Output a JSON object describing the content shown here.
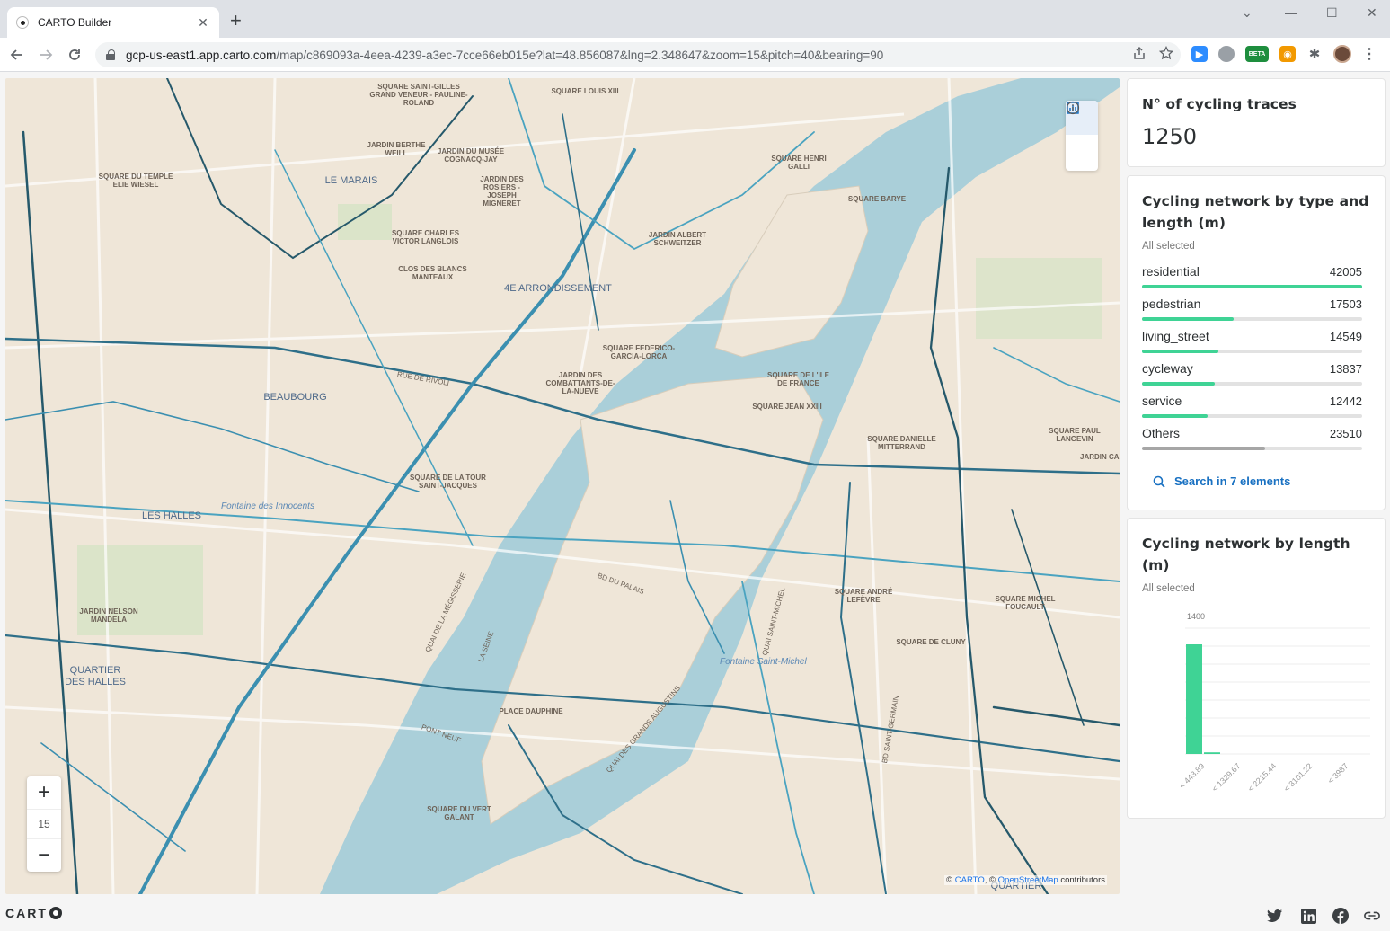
{
  "browser": {
    "tab_title": "CARTO Builder",
    "url_host": "gcp-us-east1.app.carto.com",
    "url_path": "/map/c869093a-4eea-4239-a3ec-7cce66eb015e?lat=48.856087&lng=2.348647&zoom=15&pitch=40&bearing=90",
    "ext_beta_label": "BETA"
  },
  "map": {
    "zoom_level": "15",
    "attribution_prefix": "© ",
    "attribution_carto": "CARTO",
    "attribution_sep": ", © ",
    "attribution_osm": "OpenStreetMap",
    "attribution_suffix": " contributors",
    "labels": [
      "SQUARE SAINT-GILLES GRAND VENEUR - PAULINE-ROLAND",
      "SQUARE LOUIS XIII",
      "JARDIN BERTHE WEILL",
      "JARDIN DU MUSÉE COGNACQ-JAY",
      "SQUARE DU TEMPLE ELIE WIESEL",
      "JARDIN DES ROSIERS - JOSEPH MIGNERET",
      "SQUARE HENRI GALLI",
      "SQUARE BARYE",
      "SQUARE CHARLES VICTOR LANGLOIS",
      "JARDIN ALBERT SCHWEITZER",
      "CLOS DES BLANCS MANTEAUX",
      "SQUARE FEDERICO-GARCIA-LORCA",
      "JARDIN DES COMBATTANTS-DE-LA-NUEVE",
      "SQUARE DE L'ILE DE FRANCE",
      "SQUARE JEAN XXIII",
      "SQUARE DANIELLE MITTERRAND",
      "SQUARE PAUL LANGEVIN",
      "SQUARE DE LA TOUR SAINT-JACQUES",
      "JARDIN NELSON MANDELA",
      "SQUARE ANDRÉ LEFÈVRE",
      "SQUARE MICHEL FOUCAULT",
      "SQUARE DE CLUNY",
      "PLACE DAUPHINE",
      "SQUARE DU VERT GALANT"
    ],
    "districts": [
      "LE MARAIS",
      "4E ARRONDISSEMENT",
      "BEAUBOURG",
      "LES HALLES",
      "QUARTIER DES HALLES",
      "QUARTIER",
      "JARDIN CA"
    ],
    "water_labels": [
      "Fontaine des Innocents",
      "Fontaine Saint-Michel"
    ],
    "street_labels": [
      "La Seine",
      "Quai Saint-Michel",
      "Bd Saint-Germain",
      "Quai des Grands Augustins",
      "Pont Neuf",
      "Rue de Rivoli",
      "Quai de la Mégisserie",
      "Bd du Palais"
    ]
  },
  "widgets": {
    "traces": {
      "title": "N° of cycling traces",
      "value": "1250"
    },
    "by_type": {
      "title": "Cycling network by type and length (m)",
      "subtitle": "All selected",
      "max_value": 42005,
      "categories": [
        {
          "name": "residential",
          "value": 42005,
          "value_label": "42005",
          "color": "#3fd395"
        },
        {
          "name": "pedestrian",
          "value": 17503,
          "value_label": "17503",
          "color": "#3fd395"
        },
        {
          "name": "living_street",
          "value": 14549,
          "value_label": "14549",
          "color": "#3fd395"
        },
        {
          "name": "cycleway",
          "value": 13837,
          "value_label": "13837",
          "color": "#3fd395"
        },
        {
          "name": "service",
          "value": 12442,
          "value_label": "12442",
          "color": "#3fd395"
        },
        {
          "name": "Others",
          "value": 23510,
          "value_label": "23510",
          "color": "#a6a6a6"
        }
      ],
      "search_label": "Search in 7 elements"
    },
    "by_length": {
      "title": "Cycling network by length (m)",
      "subtitle": "All selected"
    }
  },
  "chart_data": {
    "type": "bar",
    "title": "Cycling network by length (m)",
    "categories": [
      "< 443.89",
      "< 1329.67",
      "< 2215.44",
      "< 3101.22",
      "< 3987"
    ],
    "values": [
      1220,
      18,
      0,
      0,
      0
    ],
    "y_tick_labels": [
      "1400"
    ],
    "ylim": [
      0,
      1400
    ],
    "grid": true,
    "bar_color": "#3fd395"
  },
  "footer": {
    "brand": "CART"
  }
}
